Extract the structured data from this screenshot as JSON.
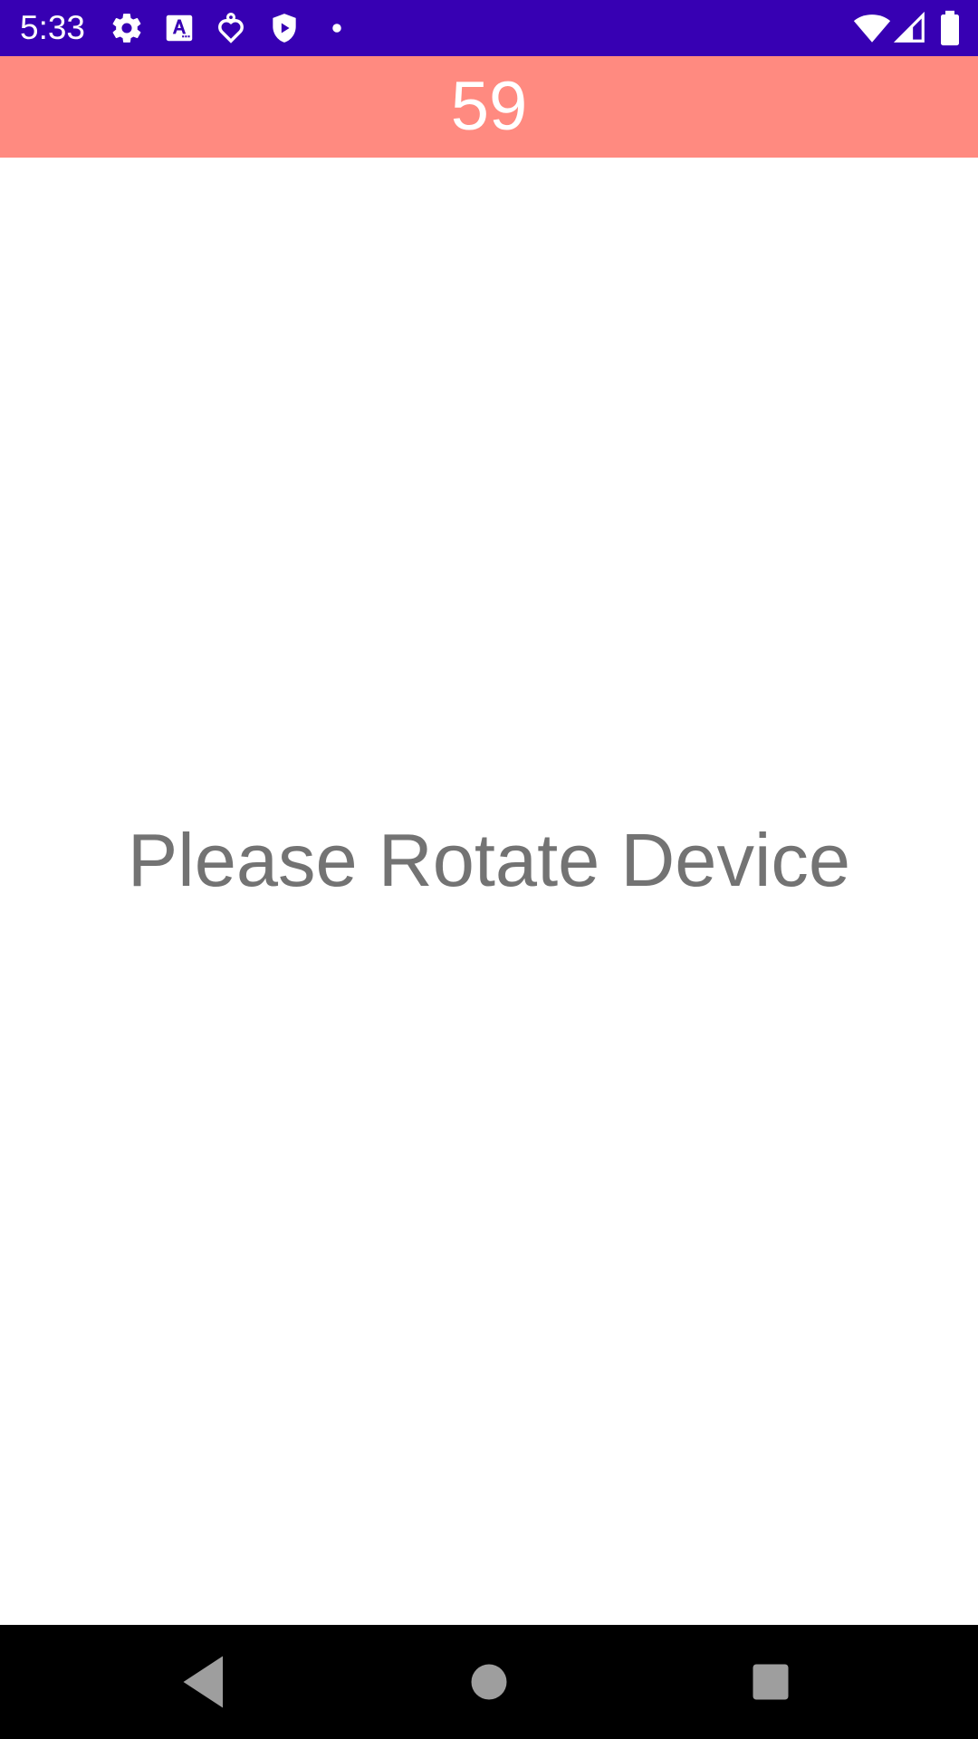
{
  "status_bar": {
    "time": "5:33",
    "background": "#3700b3",
    "left_icons": [
      "settings-icon",
      "font-a-icon",
      "location-pin-icon",
      "shield-play-icon",
      "notification-dot-icon"
    ],
    "right_icons": [
      "wifi-icon",
      "cellular-signal-icon",
      "battery-icon"
    ]
  },
  "header": {
    "counter": "59",
    "background": "#ff8a80"
  },
  "main": {
    "message": "Please Rotate Device",
    "message_color": "#737373"
  },
  "nav_bar": {
    "buttons": [
      "back-icon",
      "home-icon",
      "recents-icon"
    ]
  }
}
